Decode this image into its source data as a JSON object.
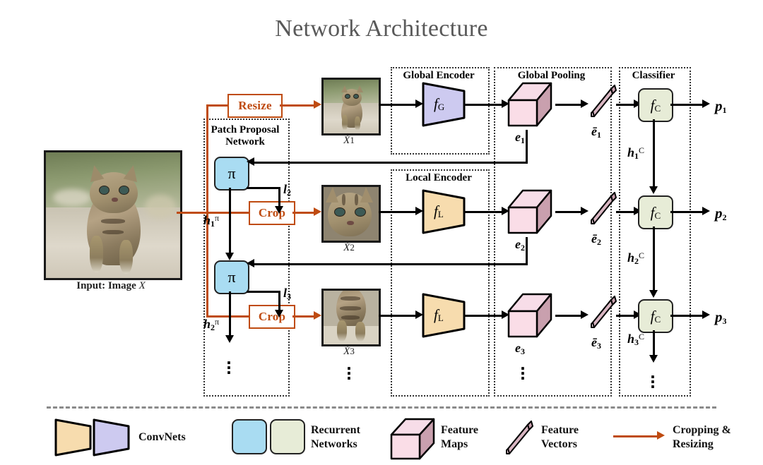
{
  "title": "Network Architecture",
  "groups": {
    "patch_proposal": "Patch Proposal\nNetwork",
    "patch_proposal_l1": "Patch Proposal",
    "patch_proposal_l2": "Network",
    "global_encoder": "Global Encoder",
    "local_encoder": "Local Encoder",
    "global_pooling": "Global Pooling",
    "classifier": "Classifier"
  },
  "input": {
    "caption_prefix": "Input: Image",
    "caption_symbol": "X"
  },
  "ops": {
    "resize": "Resize",
    "crop2": "Crop",
    "crop3": "Crop"
  },
  "patches": [
    {
      "label_base": "X",
      "label_sub": "1"
    },
    {
      "label_base": "X",
      "label_sub": "2"
    },
    {
      "label_base": "X",
      "label_sub": "3"
    }
  ],
  "encoders": [
    {
      "fn": "f",
      "sub": "G",
      "kind": "global"
    },
    {
      "fn": "f",
      "sub": "L",
      "kind": "local"
    },
    {
      "fn": "f",
      "sub": "L",
      "kind": "local"
    }
  ],
  "feature_maps": [
    {
      "base": "e",
      "sub": "1"
    },
    {
      "base": "e",
      "sub": "2"
    },
    {
      "base": "e",
      "sub": "3"
    }
  ],
  "feature_vectors": [
    {
      "base": "ē",
      "sub": "1"
    },
    {
      "base": "ē",
      "sub": "2"
    },
    {
      "base": "ē",
      "sub": "3"
    }
  ],
  "classifiers": [
    {
      "fn": "f",
      "sub": "C"
    },
    {
      "fn": "f",
      "sub": "C"
    },
    {
      "fn": "f",
      "sub": "C"
    }
  ],
  "outputs": [
    {
      "base": "p",
      "sub": "1"
    },
    {
      "base": "p",
      "sub": "2"
    },
    {
      "base": "p",
      "sub": "3"
    }
  ],
  "policy_boxes": [
    {
      "symbol": "π"
    },
    {
      "symbol": "π"
    }
  ],
  "locations": [
    {
      "base": "l",
      "sub": "2"
    },
    {
      "base": "l",
      "sub": "3"
    }
  ],
  "policy_hidden": [
    {
      "base": "h",
      "sub": "1",
      "sup": "π"
    },
    {
      "base": "h",
      "sub": "2",
      "sup": "π"
    }
  ],
  "classifier_hidden": [
    {
      "base": "h",
      "sub": "1",
      "sup": "C"
    },
    {
      "base": "h",
      "sub": "2",
      "sup": "C"
    },
    {
      "base": "h",
      "sub": "3",
      "sup": "C"
    }
  ],
  "ellipsis": "⋮",
  "legend": [
    {
      "name": "convnets",
      "label_l1": "ConvNets",
      "label_l2": ""
    },
    {
      "name": "recurrent-networks",
      "label_l1": "Recurrent",
      "label_l2": "Networks"
    },
    {
      "name": "feature-maps",
      "label_l1": "Feature",
      "label_l2": "Maps"
    },
    {
      "name": "feature-vectors",
      "label_l1": "Feature",
      "label_l2": "Vectors"
    },
    {
      "name": "cropping-resizing",
      "label_l1": "Cropping &",
      "label_l2": "Resizing"
    }
  ],
  "colors": {
    "title": "#595959",
    "conv_local": "#f7dcae",
    "conv_global": "#cdcaf0",
    "rnn_policy": "#a9dcf2",
    "rnn_classifier": "#e7ecd7",
    "fmap_front": "#fadde7",
    "fmap_top": "#f6dde8",
    "fmap_side": "#c9a0ae",
    "accent_orange": "#bf4b10",
    "stroke": "#000000",
    "divider": "#8a8a8a"
  }
}
